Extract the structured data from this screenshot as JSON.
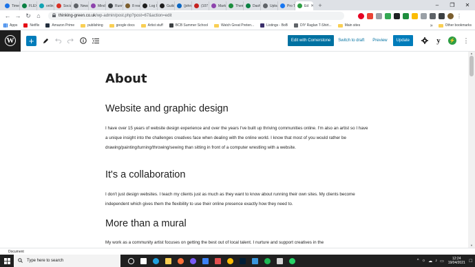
{
  "browser": {
    "tabs": [
      {
        "label": "Time",
        "color": "#1a73e8"
      },
      {
        "label": "FLEX",
        "color": "#0b8043"
      },
      {
        "label": "onlin",
        "color": "#12a4b4"
      },
      {
        "label": "Socia",
        "color": "#d93025"
      },
      {
        "label": "News",
        "color": "#5f6368"
      },
      {
        "label": "Mind",
        "color": "#8e44ad"
      },
      {
        "label": "Runn",
        "color": "#3c4043"
      },
      {
        "label": "8 rea",
        "color": "#7b5e2e"
      },
      {
        "label": "Log I",
        "color": "#1e1e1e"
      },
      {
        "label": "Guild",
        "color": "#1e1e1e"
      },
      {
        "label": "(john",
        "color": "#0a66c2"
      },
      {
        "label": "(107",
        "color": "#c5221f"
      },
      {
        "label": "Mark",
        "color": "#8e44ad"
      },
      {
        "label": "Them",
        "color": "#1e8e3e"
      },
      {
        "label": "Dash",
        "color": "#0b8043"
      },
      {
        "label": "Uploa",
        "color": "#5f6368"
      },
      {
        "label": "Pro T",
        "color": "#1877f2"
      },
      {
        "label": "Ed",
        "color": "#2e9e44",
        "active": true
      }
    ],
    "new_tab_symbol": "+",
    "window_controls": {
      "minimize": "–",
      "maximize": "❐",
      "close": "✕"
    },
    "nav": {
      "back": "←",
      "forward": "→",
      "reload": "↻",
      "home": "⌂"
    },
    "url_domain": "thinking-green.co.uk",
    "url_path": "/wp-admin/post.php?post=67&action=edit",
    "extension_colors": [
      "#e60023",
      "#ea4335",
      "#9aa0a6",
      "#34a853",
      "#202124",
      "#1e8e3e",
      "#fbbc04",
      "#9aa0a6",
      "#5f6368",
      "#3c4043"
    ],
    "bookmarks": [
      {
        "label": "Apps",
        "kind": "apps"
      },
      {
        "label": "Netflix",
        "kind": "icon",
        "color": "#e50914"
      },
      {
        "label": "Amazon Prime",
        "kind": "icon",
        "color": "#232f3e"
      },
      {
        "label": "publishing",
        "kind": "folder"
      },
      {
        "label": "google docs",
        "kind": "folder"
      },
      {
        "label": "Artist stuff",
        "kind": "folder"
      },
      {
        "label": "BCB Summer School",
        "kind": "icon",
        "color": "#3c4043"
      },
      {
        "label": "Watch Great Preten...",
        "kind": "folder"
      },
      {
        "label": "Listings - BoB",
        "kind": "icon",
        "color": "#3b2f6b"
      },
      {
        "label": "DIY Raglan T-Shirt...",
        "kind": "icon",
        "color": "#5f6368"
      },
      {
        "label": "Main sites",
        "kind": "folder"
      }
    ],
    "bookmarks_more": "»",
    "other_bookmarks": "Other bookmarks"
  },
  "editor_toolbar": {
    "add_block": "+",
    "edit_with_cornerstone": "Edit with Cornerstone",
    "switch_to_draft": "Switch to draft",
    "preview": "Preview",
    "update": "Update"
  },
  "content": {
    "title": "About",
    "sections": [
      {
        "heading": "Website and graphic design",
        "paragraph": "I have over 15 years of website design experience and over the years I've built up thriving communities online. I'm also an artist so I have a unique insight into the challenges creatives face when dealing with the online world. I know that most of you would rather be drawing/painting/turning/throwing/sewing than sitting in front of a computer wrestling with a website."
      },
      {
        "heading": "It's a collaboration",
        "paragraph": "I don't just design websites. I teach my clients just as much as they want to know about running their own sites. My clients become independent which gives them the flexibility to use their online presence exactly how they need to."
      },
      {
        "heading": "More than a mural",
        "paragraph": "My work as a community artist focuses on getting the best out of local talent. I nurture and support creatives in the"
      }
    ]
  },
  "footer": {
    "breadcrumb": "Document"
  },
  "taskbar": {
    "search_placeholder": "Type here to search",
    "apps": [
      {
        "name": "cortana",
        "color": "#ffffff",
        "shape": "ring"
      },
      {
        "name": "task-view",
        "color": "#ffffff",
        "shape": "sq"
      },
      {
        "name": "edge",
        "color": "#1fa2e0",
        "shape": "dot"
      },
      {
        "name": "file-explorer",
        "color": "#f9cf54",
        "shape": "sq"
      },
      {
        "name": "firefox",
        "color": "#ff7139",
        "shape": "dot"
      },
      {
        "name": "media",
        "color": "#7a5af8",
        "shape": "dot"
      },
      {
        "name": "mail",
        "color": "#3c82f6",
        "shape": "sq"
      },
      {
        "name": "app",
        "color": "#e34f4f",
        "shape": "sq"
      },
      {
        "name": "chrome",
        "color": "#fbbc04",
        "shape": "dot"
      },
      {
        "name": "photoshop",
        "color": "#001e36",
        "shape": "sq"
      },
      {
        "name": "photos",
        "color": "#3a96dd",
        "shape": "sq"
      },
      {
        "name": "spotify",
        "color": "#1db954",
        "shape": "dot"
      },
      {
        "name": "calendar",
        "color": "#d6d6d6",
        "shape": "sq"
      },
      {
        "name": "whatsapp",
        "color": "#25d366",
        "shape": "dot"
      }
    ],
    "tray_icons": [
      "^",
      "☼",
      "☁",
      "♪",
      "▭"
    ],
    "time": "12:24",
    "date": "19/04/2021"
  }
}
